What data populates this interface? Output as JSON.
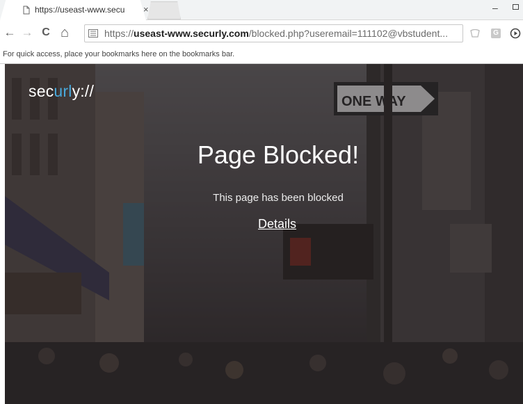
{
  "browser": {
    "tab": {
      "title": "https://useast-www.secu",
      "close_glyph": "×",
      "icon": "page-icon"
    },
    "window": {
      "minimize_glyph": "–",
      "maximize_icon": "maximize-icon"
    },
    "toolbar": {
      "back_glyph": "←",
      "forward_glyph": "→",
      "reload_glyph": "C",
      "home_glyph": "⌂",
      "star_glyph": "☆",
      "ext_icon_label": "G"
    },
    "url": {
      "prefix": "https://",
      "host": "useast-www.securly.com",
      "path": "/blocked.php?useremail=111102@vbstudent..."
    },
    "bookmarks_bar": {
      "message": "For quick access, place your bookmarks here on the bookmarks bar."
    }
  },
  "page": {
    "logo": {
      "part1": "sec",
      "accent": "url",
      "part2": "y://",
      "accent_color": "#48a9dc"
    },
    "title": "Page Blocked!",
    "message": "This page has been blocked",
    "details_link": "Details"
  }
}
